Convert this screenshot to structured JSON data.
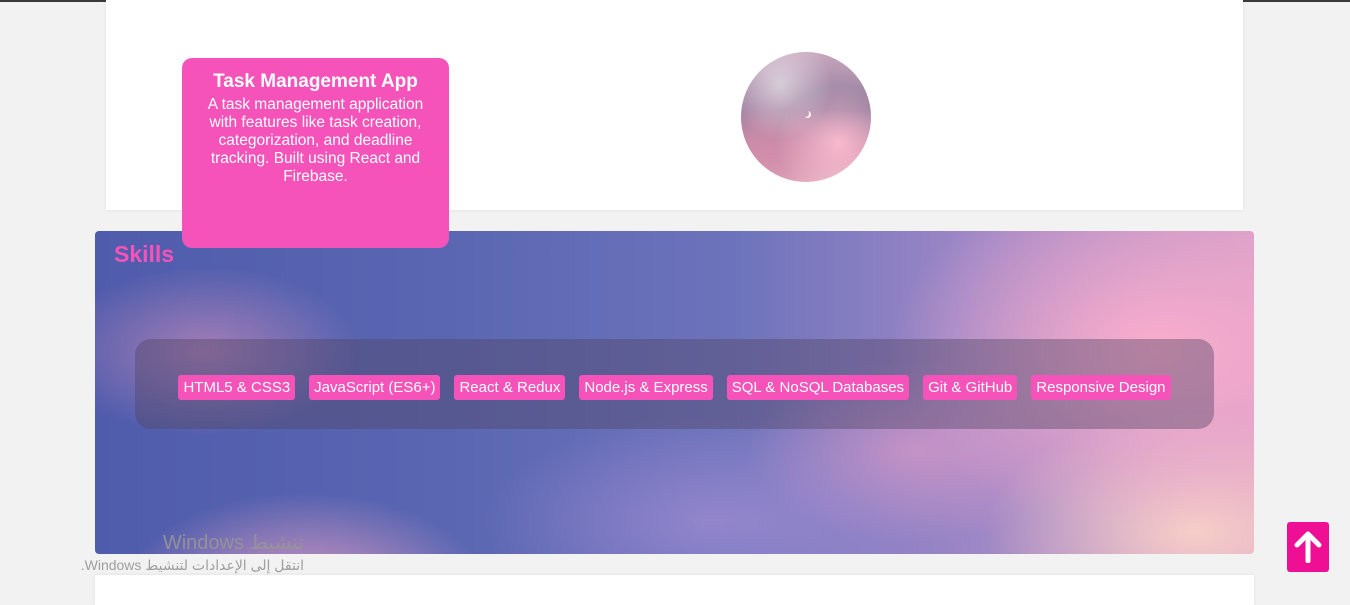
{
  "projects": {
    "card": {
      "title": "Task Management App",
      "description": "A task management application with features like task creation, categorization, and deadline tracking. Built using React and Firebase."
    }
  },
  "skills": {
    "title": "Skills",
    "items": [
      "HTML5 & CSS3",
      "JavaScript (ES6+)",
      "React & Redux",
      "Node.js & Express",
      "SQL & NoSQL Databases",
      "Git & GitHub",
      "Responsive Design"
    ]
  },
  "watermark": {
    "title": "تنشيط Windows",
    "subtitle": "انتقل إلى الإعدادات لتنشيط Windows."
  },
  "scroll_top": {
    "icon": "arrow-up-icon"
  },
  "colors": {
    "accent": "#f553b9",
    "scroll_button": "#ef0f95"
  }
}
